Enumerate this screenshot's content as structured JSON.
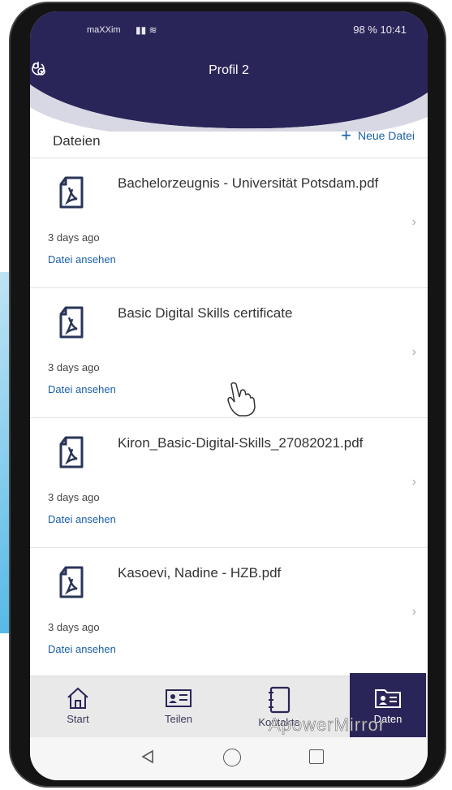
{
  "status_bar": {
    "carrier": "maXXim",
    "right": "98 %  10:41"
  },
  "header": {
    "title": "Profil 2"
  },
  "section": {
    "title": "Dateien",
    "new_file": "Neue Datei"
  },
  "files": [
    {
      "name": "Bachelorzeugnis - Universität Potsdam.pdf",
      "date": "3 days ago",
      "link": "Datei ansehen"
    },
    {
      "name": "Basic Digital Skills certificate",
      "date": "3 days ago",
      "link": "Datei ansehen"
    },
    {
      "name": "Kiron_Basic-Digital-Skills_27082021.pdf",
      "date": "3 days ago",
      "link": "Datei ansehen"
    },
    {
      "name": "Kasoevi, Nadine - HZB.pdf",
      "date": "3 days ago",
      "link": "Datei ansehen"
    }
  ],
  "tabs": [
    {
      "label": "Start",
      "icon": "home-icon"
    },
    {
      "label": "Teilen",
      "icon": "id-card-icon"
    },
    {
      "label": "Kontakte",
      "icon": "address-book-icon"
    },
    {
      "label": "Daten",
      "icon": "folder-id-icon",
      "active": true
    }
  ],
  "watermark": "ApowerMirror",
  "colors": {
    "header_bg": "#2a2558",
    "accent": "#1a5fa8",
    "active_tab": "#2a2558"
  }
}
